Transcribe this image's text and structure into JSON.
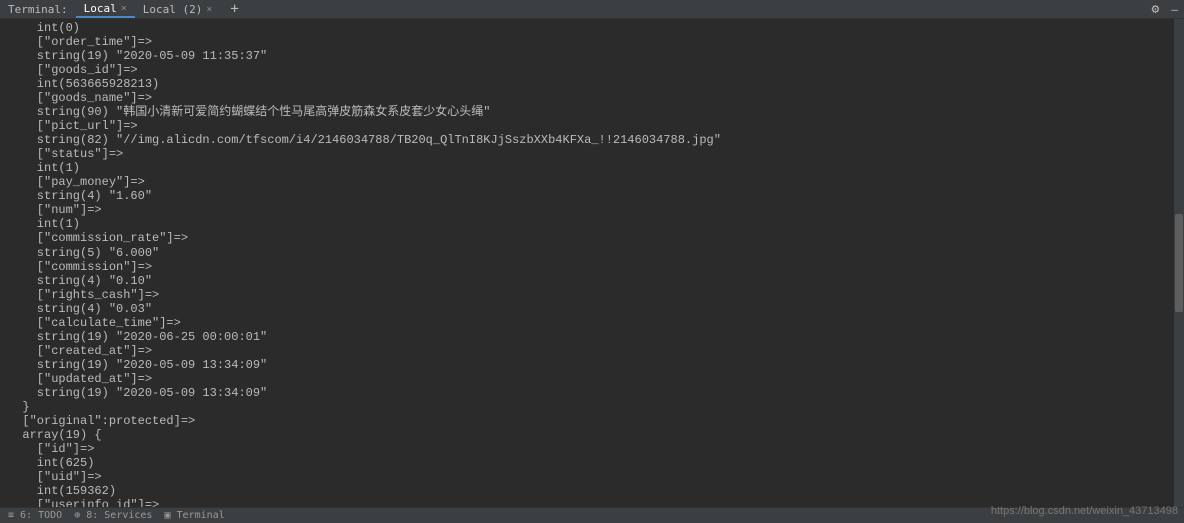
{
  "tabBar": {
    "terminalLabel": "Terminal:",
    "tabs": [
      {
        "label": "Local",
        "active": true
      },
      {
        "label": "Local (2)",
        "active": false
      }
    ],
    "addIcon": "+",
    "gearIcon": "⚙",
    "minimizeIcon": "—"
  },
  "terminal": {
    "lines": [
      "    int(0)",
      "    [\"order_time\"]=>",
      "    string(19) \"2020-05-09 11:35:37\"",
      "    [\"goods_id\"]=>",
      "    int(563665928213)",
      "    [\"goods_name\"]=>",
      "    string(90) \"韩国小清新可爱简约蝴蝶结个性马尾高弹皮筋森女系皮套少女心头绳\"",
      "    [\"pict_url\"]=>",
      "    string(82) \"//img.alicdn.com/tfscom/i4/2146034788/TB20q_QlTnI8KJjSszbXXb4KFXa_!!2146034788.jpg\"",
      "    [\"status\"]=>",
      "    int(1)",
      "    [\"pay_money\"]=>",
      "    string(4) \"1.60\"",
      "    [\"num\"]=>",
      "    int(1)",
      "    [\"commission_rate\"]=>",
      "    string(5) \"6.000\"",
      "    [\"commission\"]=>",
      "    string(4) \"0.10\"",
      "    [\"rights_cash\"]=>",
      "    string(4) \"0.03\"",
      "    [\"calculate_time\"]=>",
      "    string(19) \"2020-06-25 00:00:01\"",
      "    [\"created_at\"]=>",
      "    string(19) \"2020-05-09 13:34:09\"",
      "    [\"updated_at\"]=>",
      "    string(19) \"2020-05-09 13:34:09\"",
      "  }",
      "  [\"original\":protected]=>",
      "  array(19) {",
      "    [\"id\"]=>",
      "    int(625)",
      "    [\"uid\"]=>",
      "    int(159362)",
      "    [\"userinfo_id\"]=>"
    ]
  },
  "statusBar": {
    "todo": "≡ 6: TODO",
    "services": "⊕ 8: Services",
    "terminal": "▣ Terminal"
  },
  "watermark": "https://blog.csdn.net/weixin_43713498"
}
